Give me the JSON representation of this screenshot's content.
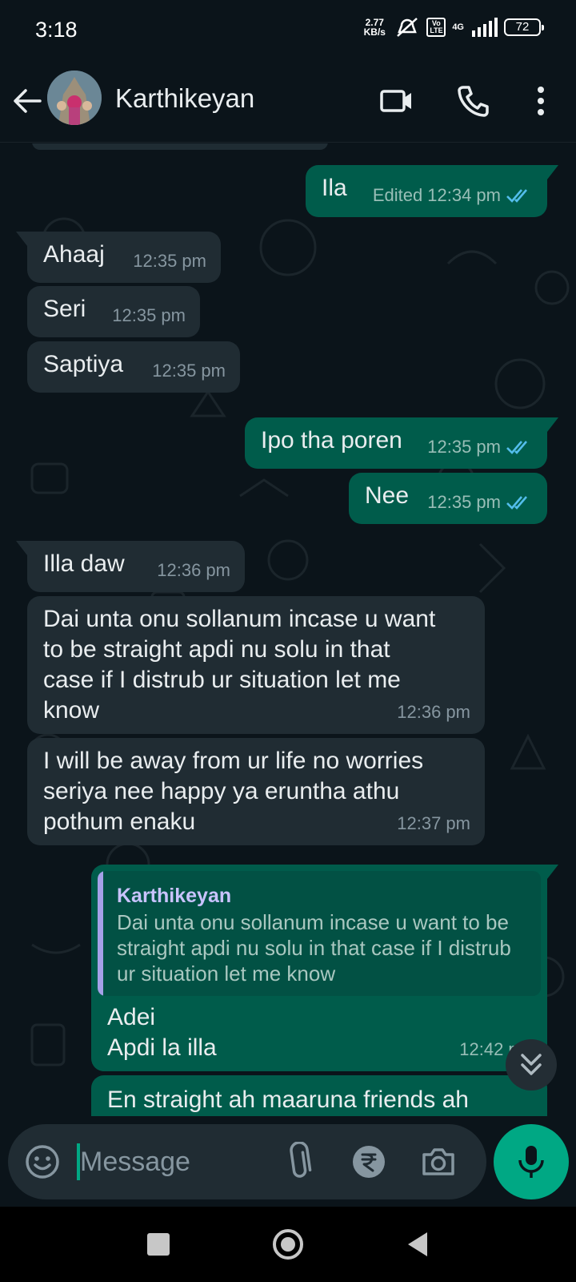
{
  "status_bar": {
    "time": "3:18",
    "net_speed": "2.77\nKB/s",
    "volte": "Vo\nLTE",
    "network": "4G",
    "battery": "72"
  },
  "header": {
    "contact_name": "Karthikeyan",
    "icons": [
      "back-arrow-icon",
      "video-call-icon",
      "voice-call-icon",
      "more-options-icon"
    ]
  },
  "messages": [
    {
      "direction": "out",
      "text": "Ila",
      "edited_label": "Edited",
      "time": "12:34 pm",
      "ticks": "read"
    },
    {
      "direction": "in",
      "text": "Ahaaj",
      "time": "12:35 pm"
    },
    {
      "direction": "in",
      "text": "Seri",
      "time": "12:35 pm"
    },
    {
      "direction": "in",
      "text": "Saptiya",
      "time": "12:35 pm"
    },
    {
      "direction": "out",
      "text": "Ipo tha poren",
      "time": "12:35 pm",
      "ticks": "read"
    },
    {
      "direction": "out",
      "text": "Nee",
      "time": "12:35 pm",
      "ticks": "read"
    },
    {
      "direction": "in",
      "text": "Illa daw",
      "time": "12:36 pm"
    },
    {
      "direction": "in",
      "text": "Dai unta onu sollanum incase u want\nto be straight apdi nu solu in that\ncase if I distrub ur situation let me\nknow",
      "time": "12:36 pm"
    },
    {
      "direction": "in",
      "text": "I will be away from ur life no worries\nseriya nee happy ya eruntha athu\npothum enaku",
      "time": "12:37 pm"
    },
    {
      "direction": "out",
      "quote": {
        "author": "Karthikeyan",
        "text": "Dai unta onu sollanum incase u want to be straight apdi nu solu in that case if I distrub ur situation let me know"
      },
      "text": "Adei\nApdi la illa",
      "time": "12:42 pm"
    },
    {
      "direction": "out",
      "text": "En straight ah maaruna friends ah",
      "partial": true
    }
  ],
  "input": {
    "placeholder": "Message"
  },
  "colors": {
    "background": "#0b141a",
    "incoming_bubble": "#202c33",
    "outgoing_bubble": "#005c4b",
    "accent": "#00a884",
    "read_ticks": "#53bdeb",
    "quote_author": "#c9c3ff"
  }
}
